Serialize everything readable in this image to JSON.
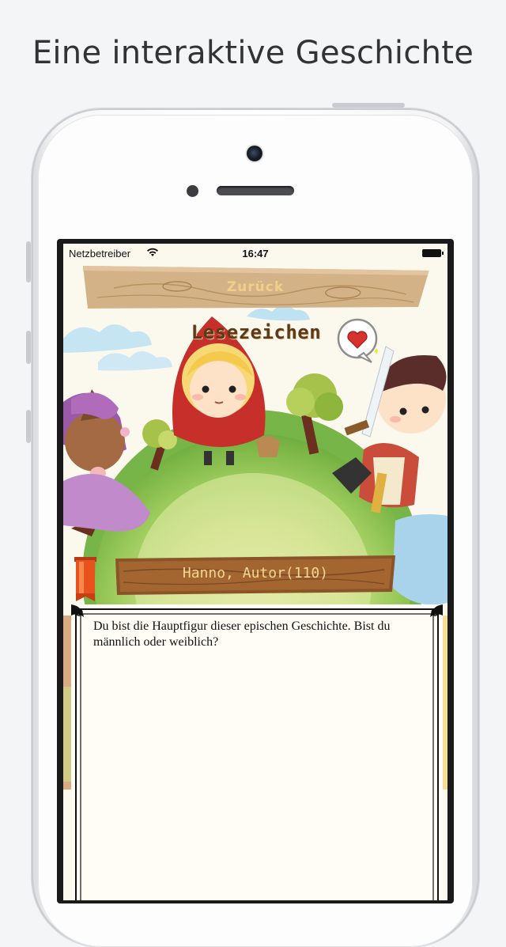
{
  "headline": "Eine interaktive Geschichte",
  "statusbar": {
    "carrier": "Netzbetreiber",
    "time": "16:47"
  },
  "nav": {
    "back_label": "Zurück"
  },
  "bookmarks": {
    "title": "Lesezeichen",
    "favorite_icon": "heart-speech-bubble-icon"
  },
  "story": {
    "author_label": "Hanno, Autor(110)",
    "text": "Du bist die Hauptfigur dieser epischen Geschichte. Bist du männlich oder weiblich?",
    "bookmark_icon": "bookmark-ribbon-icon"
  },
  "colors": {
    "wood": "#c9a57a",
    "wood_dark": "#7a4a22",
    "panel": "#fffdf6",
    "grass": "#8cc04f",
    "ribbon": "#e8521c"
  }
}
